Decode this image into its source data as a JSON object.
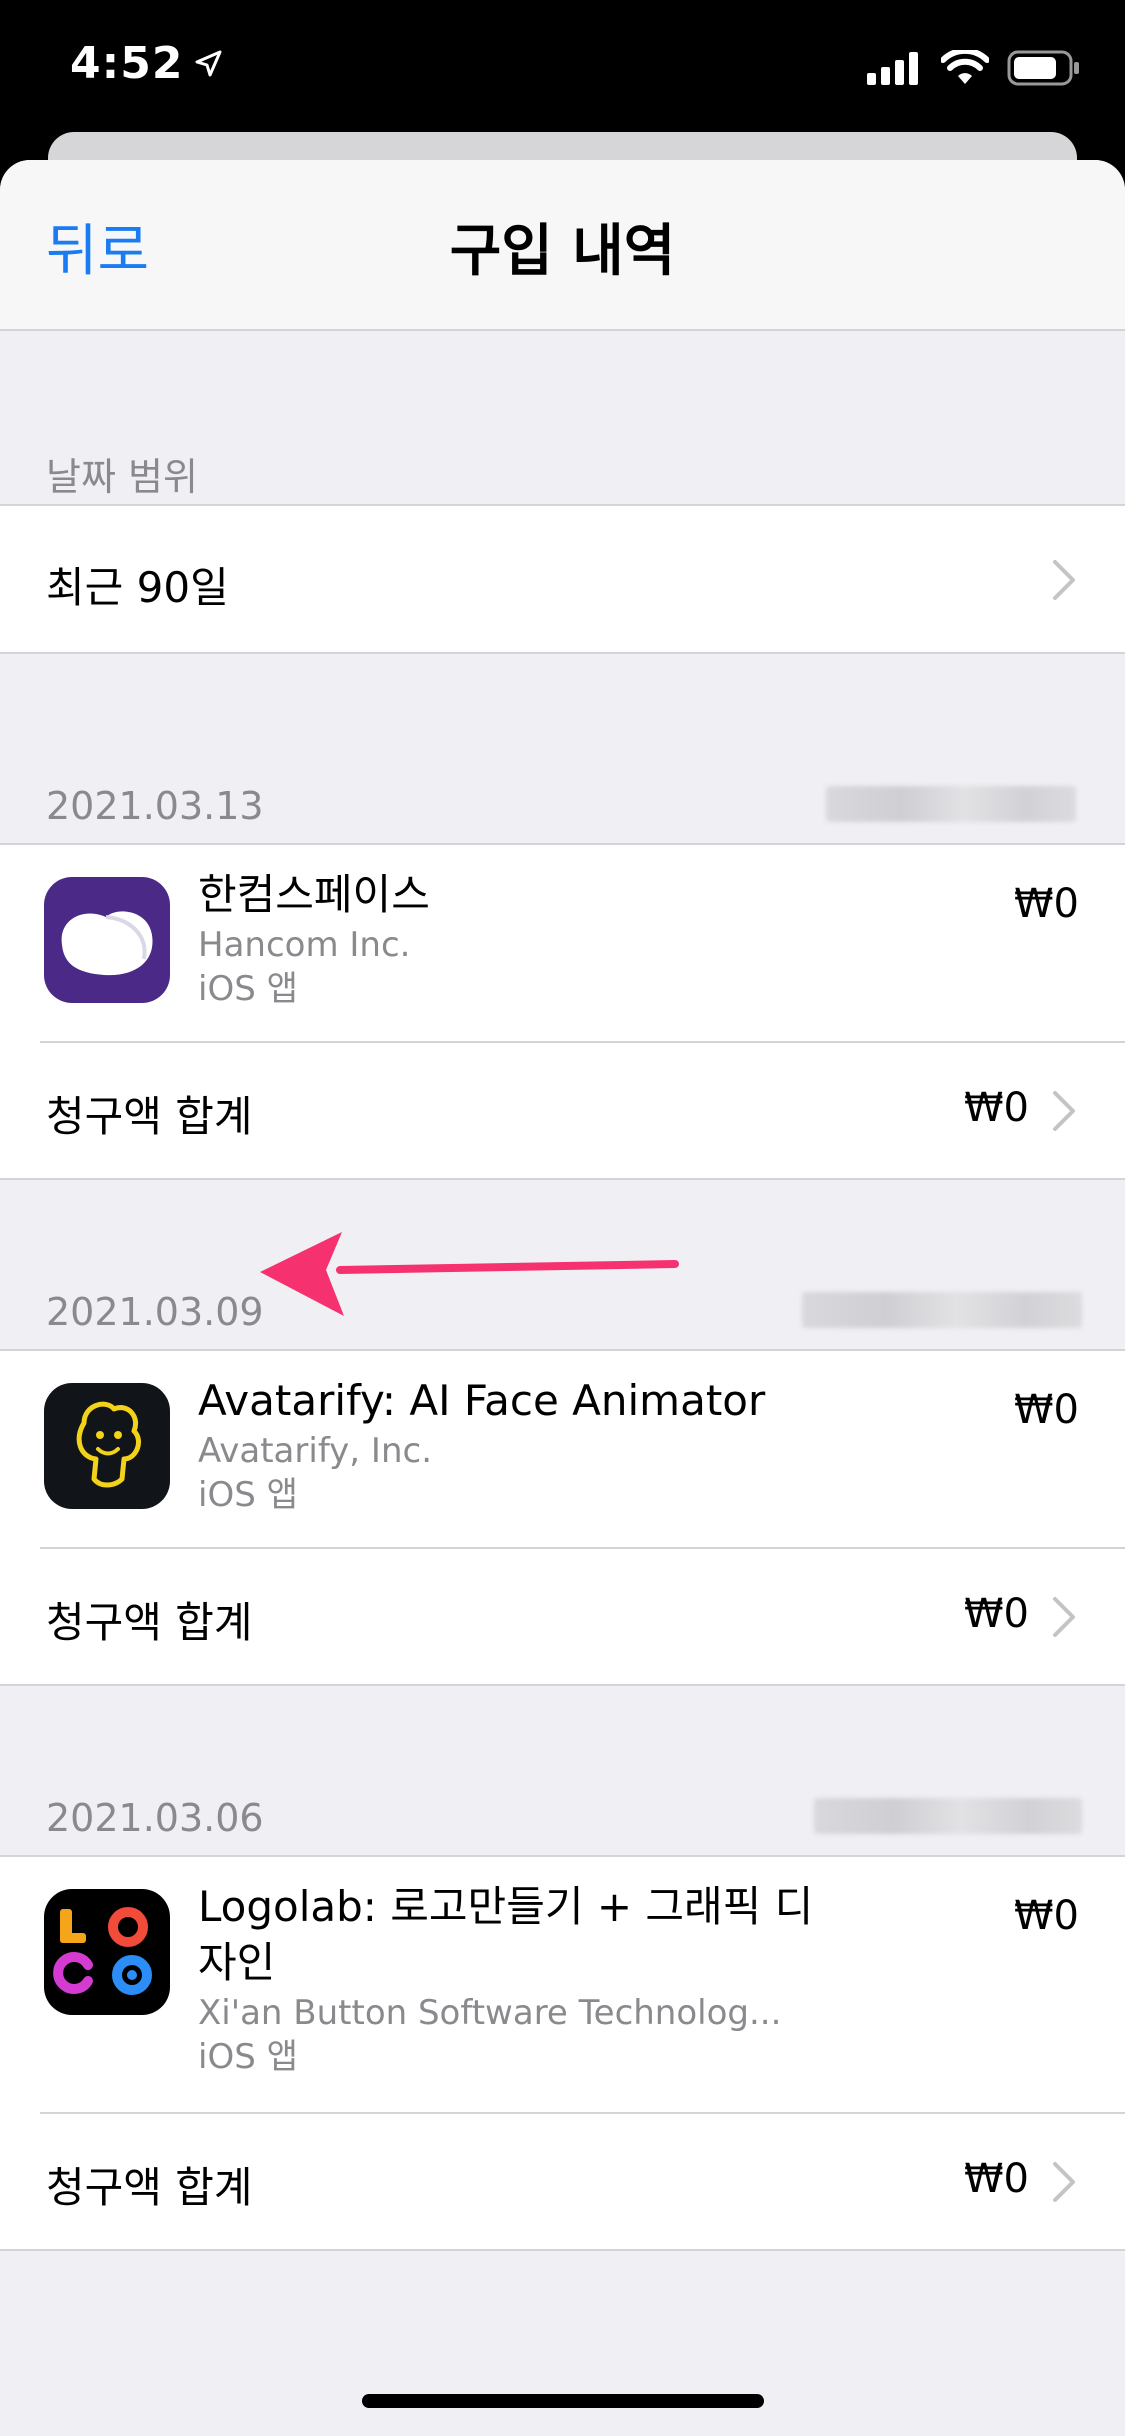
{
  "status_bar": {
    "time": "4:52"
  },
  "nav": {
    "back_label": "뒤로",
    "title": "구입 내역"
  },
  "date_range": {
    "header": "날짜 범위",
    "value": "최근 90일"
  },
  "purchases": [
    {
      "date": "2021.03.13",
      "app_name": "한컴스페이스",
      "developer": "Hancom Inc.",
      "type": "iOS 앱",
      "price": "₩0",
      "total_label": "청구액 합계",
      "total_price": "₩0",
      "icon": "hancom-space-icon"
    },
    {
      "date": "2021.03.09",
      "app_name": "Avatarify: AI Face Animator",
      "developer": "Avatarify, Inc.",
      "type": "iOS 앱",
      "price": "₩0",
      "total_label": "청구액 합계",
      "total_price": "₩0",
      "icon": "avatarify-icon"
    },
    {
      "date": "2021.03.06",
      "app_name": "Logolab: 로고만들기 + 그래픽 디자인",
      "developer": "Xi'an Button Software Technolog...",
      "type": "iOS 앱",
      "price": "₩0",
      "total_label": "청구액 합계",
      "total_price": "₩0",
      "icon": "logolab-icon"
    }
  ],
  "colors": {
    "accent": "#1a7cf5",
    "arrow": "#f5316f",
    "background": "#efeff4",
    "secondary_text": "#8a8a8e"
  }
}
